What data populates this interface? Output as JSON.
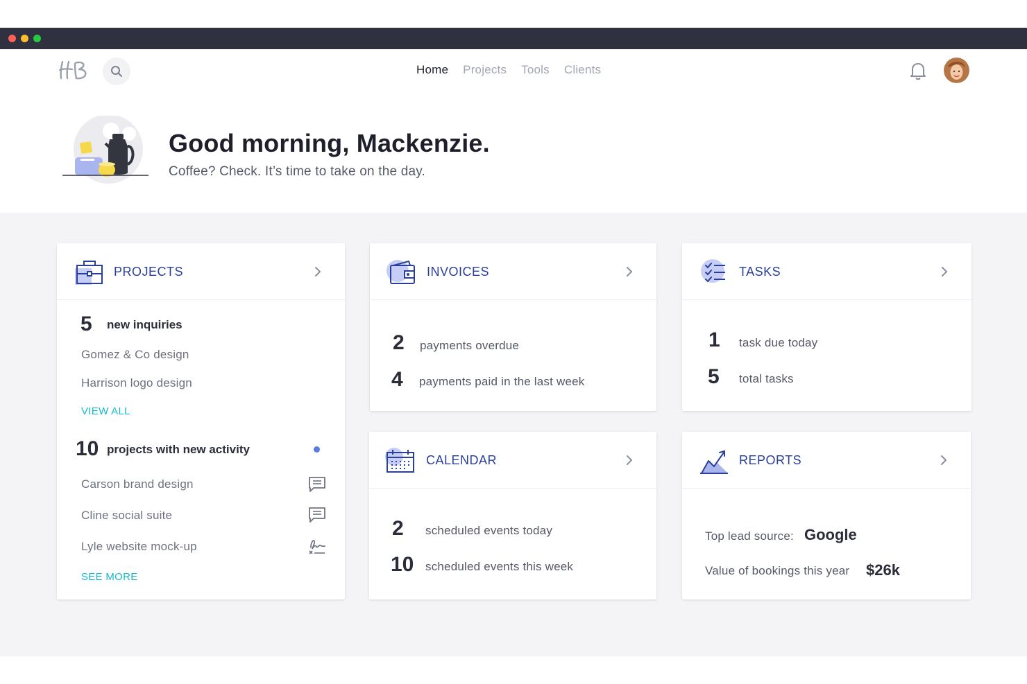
{
  "nav": {
    "logo_text": "HB",
    "items": [
      {
        "label": "Home",
        "active": true
      },
      {
        "label": "Projects",
        "active": false
      },
      {
        "label": "Tools",
        "active": false
      },
      {
        "label": "Clients",
        "active": false
      }
    ]
  },
  "hero": {
    "greeting": "Good morning, Mackenzie.",
    "subtitle": "Coffee? Check. It’s time to take on the day."
  },
  "projects": {
    "title": "PROJECTS",
    "inquiries_count": "5",
    "inquiries_label": "new inquiries",
    "inquiries": [
      "Gomez & Co design",
      "Harrison logo design"
    ],
    "view_all": "VIEW ALL",
    "activity_count": "10",
    "activity_label": "projects with new activity",
    "activity_items": [
      {
        "label": "Carson brand design",
        "icon": "message-icon"
      },
      {
        "label": "Cline social suite",
        "icon": "message-icon"
      },
      {
        "label": "Lyle website mock-up",
        "icon": "signature-icon"
      }
    ],
    "see_more": "SEE MORE"
  },
  "invoices": {
    "title": "INVOICES",
    "stats": [
      {
        "count": "2",
        "label": "payments overdue"
      },
      {
        "count": "4",
        "label": "payments paid in the last week"
      }
    ]
  },
  "tasks": {
    "title": "TASKS",
    "stats": [
      {
        "count": "1",
        "label": "task due today"
      },
      {
        "count": "5",
        "label": "total tasks"
      }
    ]
  },
  "calendar": {
    "title": "CALENDAR",
    "stats": [
      {
        "count": "2",
        "label": "scheduled events today"
      },
      {
        "count": "10",
        "label": "scheduled events this week"
      }
    ]
  },
  "reports": {
    "title": "REPORTS",
    "lead_label": "Top lead source:",
    "lead_value": "Google",
    "bookings_label": "Value of bookings this year",
    "bookings_value": "$26k"
  },
  "colors": {
    "accent_blue": "#2a3f9a",
    "icon_bg": "#c7cef5",
    "link_teal": "#18b8cf",
    "activity_dot": "#5c7be0",
    "titlebar": "#2f3140",
    "dashboard_bg": "#f4f4f6"
  }
}
